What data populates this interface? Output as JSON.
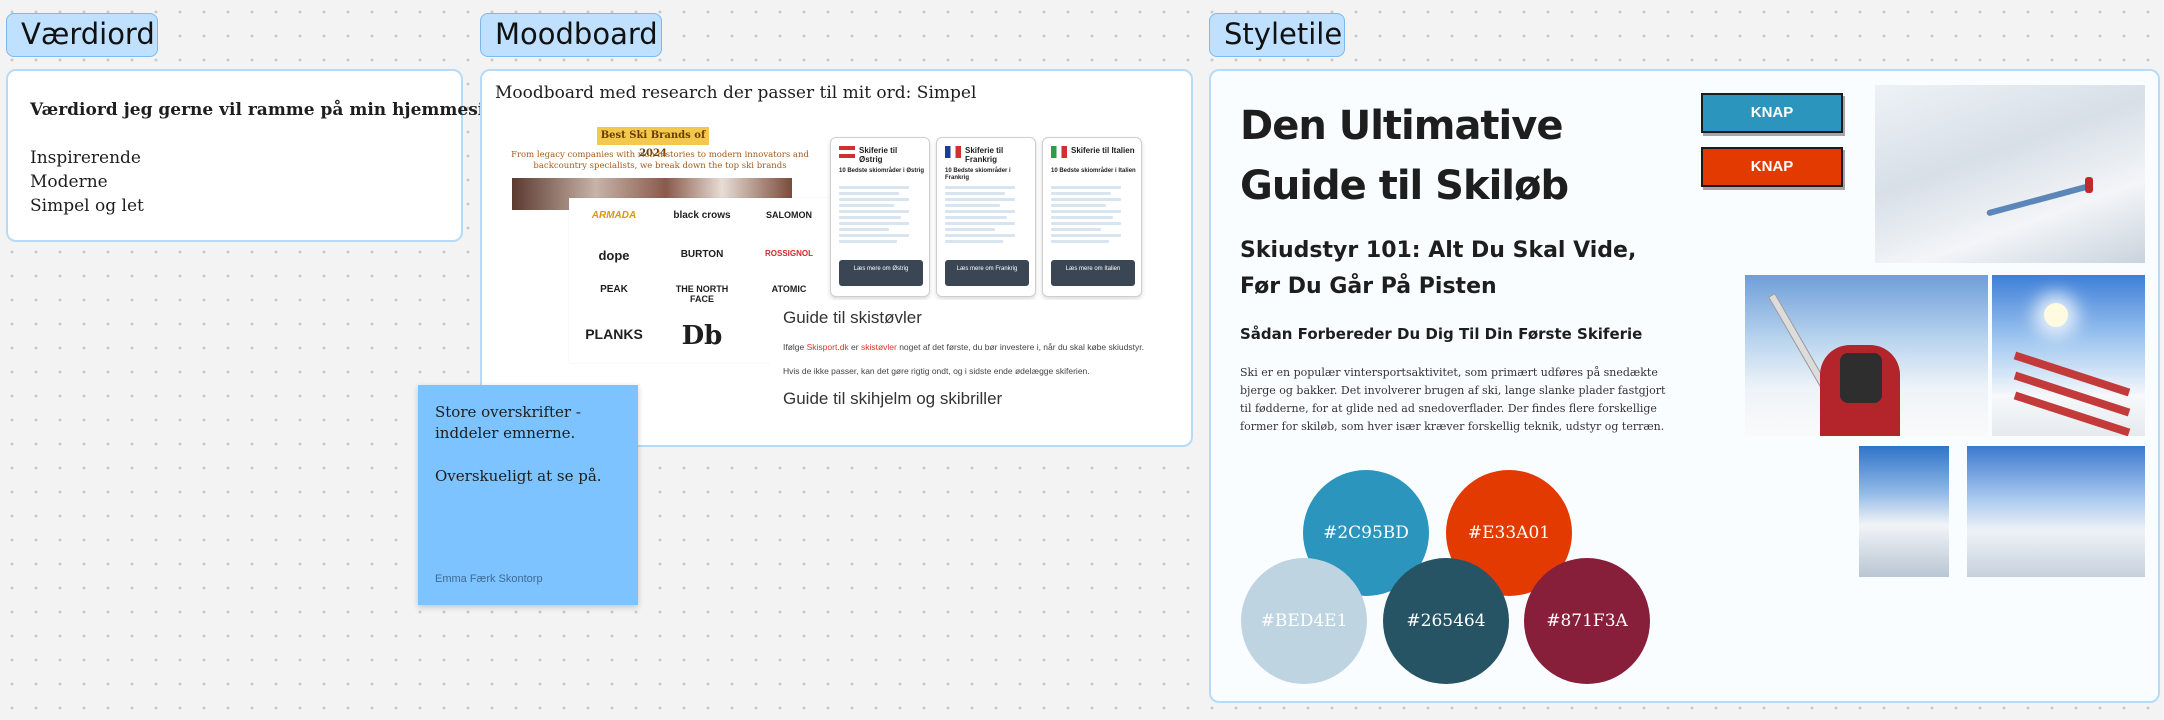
{
  "sections": {
    "vaerdiord_label": "Værdiord",
    "moodboard_label": "Moodboard",
    "styletile_label": "Styletile"
  },
  "vaerdiord": {
    "title": "Værdiord jeg gerne vil ramme på min hjemmeside",
    "items": [
      "Inspirerende",
      "Moderne",
      "Simpel og let"
    ]
  },
  "moodboard": {
    "caption": "Moodboard med research der passer til mit ord: Simpel",
    "brands": {
      "title": "Best Ski Brands of 2024",
      "subtitle": "From legacy companies with rich histories to modern innovators and backcountry specialists, we break down the top ski brands",
      "logos": [
        "ARMADA",
        "black crows",
        "SALOMON",
        "dope",
        "BURTON",
        "ROSSIGNOL",
        "PEAK",
        "THE NORTH FACE",
        "ATOMIC",
        "PLANKS",
        "Db"
      ]
    },
    "cards": [
      {
        "title": "Skiferie til Østrig",
        "subtitle": "10 Bedste skiområder i Østrig",
        "button": "Læs mere om Østrig"
      },
      {
        "title": "Skiferie til Frankrig",
        "subtitle": "10 Bedste skiområder i Frankrig",
        "button": "Læs mere om Frankrig"
      },
      {
        "title": "Skiferie til Italien",
        "subtitle": "10 Bedste skiområder i Italien",
        "button": "Læs mere om Italien"
      }
    ],
    "guide": {
      "heading": "Guide til skistøvler",
      "p1_prefix": "Ifølge ",
      "p1_link1": "Skisport.dk",
      "p1_mid": " er ",
      "p1_link2": "skistøvler",
      "p1_suffix": " noget af det første, du bør investere i, når du skal købe skiudstyr.",
      "p2": "Hvis de ikke passer, kan det gøre rigtig ondt, og i sidste ende ødelægge skiferien.",
      "heading2": "Guide til skihjelm og skibriller"
    }
  },
  "sticky": {
    "line1": "Store overskrifter - inddeler emnerne.",
    "line2": "Overskueligt at se på.",
    "author": "Emma Færk Skontorp"
  },
  "styletile": {
    "h1": "Den Ultimative Guide til Skiløb",
    "h2": "Skiudstyr 101: Alt Du Skal Vide, Før Du Går På Pisten",
    "h3": "Sådan Forbereder Du Dig Til Din Første Skiferie",
    "body": "Ski er en populær vintersportsaktivitet, som primært udføres på snedækte bjerge og bakker. Det involverer brugen af ski, lange slanke plader fastgjort til fødderne, for at glide ned ad snedoverflader. Der findes flere forskellige former for skiløb, som hver især kræver forskellig teknik, udstyr og terræn.",
    "button1": "KNAP",
    "button2": "KNAP",
    "colors": [
      "#2C95BD",
      "#E33A01",
      "#BED4E1",
      "#265464",
      "#871F3A"
    ]
  }
}
